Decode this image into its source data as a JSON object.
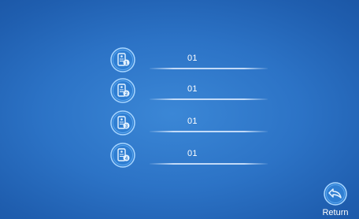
{
  "rows": [
    {
      "icon": "door-station-1-icon",
      "value": "01"
    },
    {
      "icon": "door-station-2-icon",
      "value": "01"
    },
    {
      "icon": "door-station-3-icon",
      "value": "01"
    },
    {
      "icon": "door-station-4-icon",
      "value": "01"
    }
  ],
  "return": {
    "label": "Return",
    "icon": "return-arrow-icon"
  },
  "colors": {
    "background": "#2c73c6",
    "icon_ring": "#7fc0ff",
    "text": "#ffffff"
  }
}
